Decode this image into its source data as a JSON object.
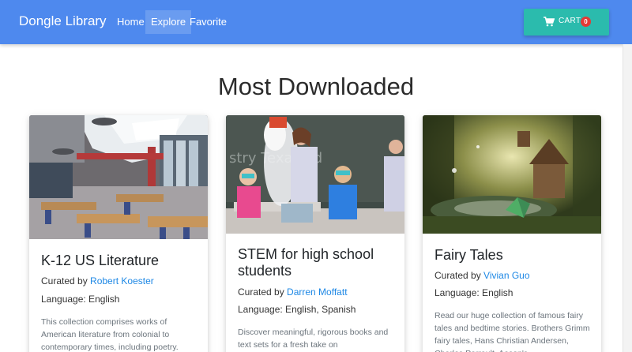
{
  "navbar": {
    "brand": "Dongle Library",
    "links": [
      "Home",
      "Explore",
      "Favorite"
    ],
    "cart_label": "CART",
    "cart_count": "0"
  },
  "main": {
    "title": "Most Downloaded",
    "cards": [
      {
        "title": "K-12 US Literature",
        "curated_prefix": "Curated by",
        "curator": "Robert Koester",
        "language": "Language: English",
        "description": "This collection comprises works of American literature from colonial to contemporary times, including poetry."
      },
      {
        "title": "STEM for high school students",
        "curated_prefix": "Curated by",
        "curator": "Darren Moffatt",
        "language": "Language: English, Spanish",
        "description": "Discover meaningful, rigorous books and text sets for a fresh take on"
      },
      {
        "title": "Fairy Tales",
        "curated_prefix": "Curated by",
        "curator": "Vivian Guo",
        "language": "Language: English",
        "description": "Read our huge collection of famous fairy tales and bedtime stories. Brothers Grimm fairy tales, Hans Christian Andersen, Charles Perrault, Aesop's"
      }
    ]
  },
  "colors": {
    "navbar": "#4e89ee",
    "cart_button": "#2bbbad",
    "badge": "#e53935",
    "link": "#1e88e5"
  },
  "icons": {
    "cart": "shopping-cart-icon"
  }
}
